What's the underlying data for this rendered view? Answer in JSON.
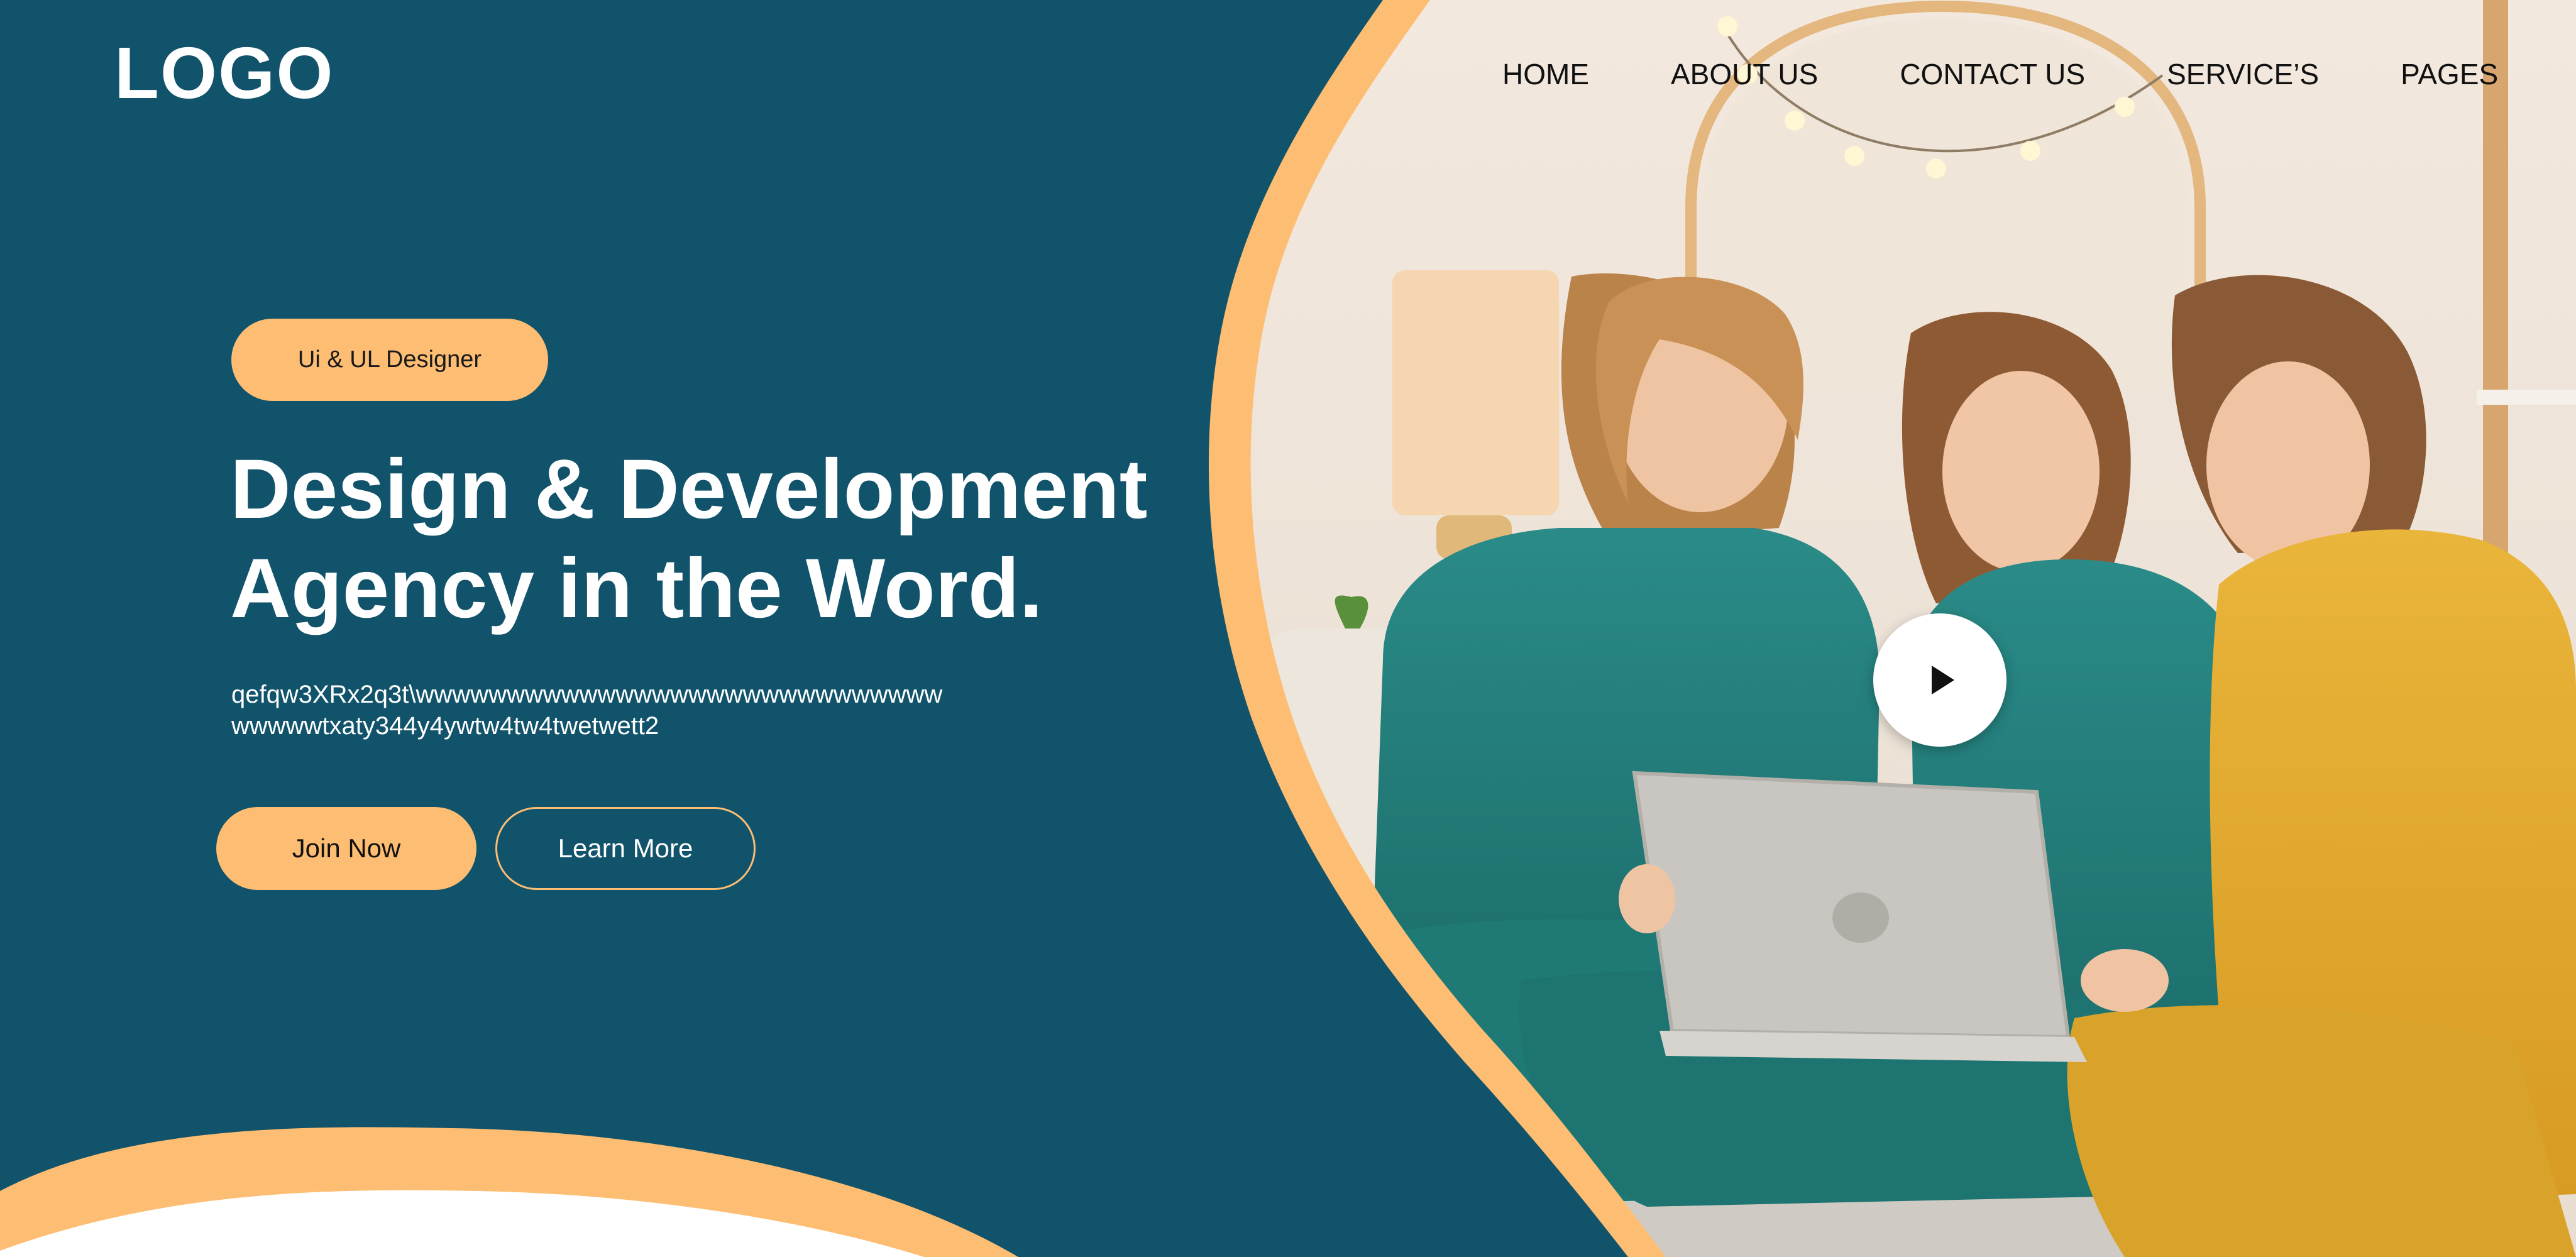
{
  "brand": {
    "logo_text": "LOGO"
  },
  "nav": {
    "items": [
      "HOME",
      "ABOUT US",
      "CONTACT US",
      "SERVICE’S",
      "PAGES"
    ]
  },
  "hero": {
    "badge": "Ui & UL Designer",
    "headline_line1": "Design & Development",
    "headline_line2": "Agency in the Word.",
    "subtext_line1": "qefqw3XRx2q3t\\wwwwwwwwwwwwwwwwwwwwwwwwwwwww",
    "subtext_line2": "wwwwwtxaty344y4ywtw4tw4twetwett2",
    "primary_cta": "Join Now",
    "secondary_cta": "Learn More"
  },
  "media": {
    "play_icon": "play-icon"
  },
  "colors": {
    "background": "#11536b",
    "accent": "#fdbd72",
    "text_light": "#ffffff",
    "text_dark": "#111111"
  }
}
